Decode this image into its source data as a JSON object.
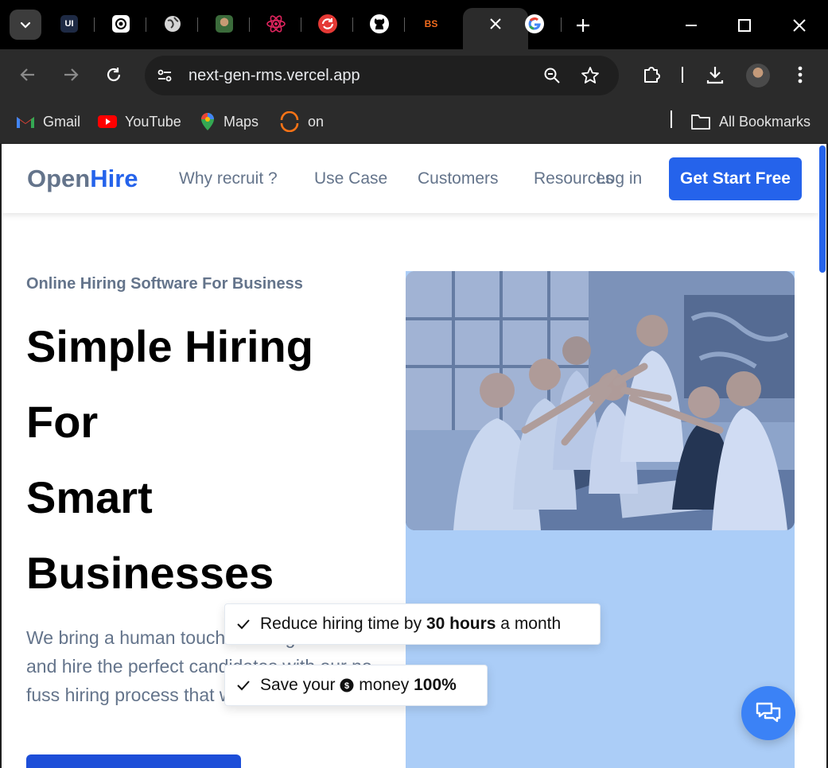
{
  "browser": {
    "tabs": [
      {
        "icon": "uiverse-icon",
        "label": "UI"
      },
      {
        "icon": "chatgpt-icon",
        "label": ""
      },
      {
        "icon": "globe-icon",
        "label": ""
      },
      {
        "icon": "profile-photo-icon",
        "label": ""
      },
      {
        "icon": "react-icon",
        "label": ""
      },
      {
        "icon": "sync-icon",
        "label": ""
      },
      {
        "icon": "github-icon",
        "label": ""
      },
      {
        "icon": "bs-icon",
        "label": "BS"
      },
      {
        "icon": "close-icon",
        "label": "",
        "active": true
      },
      {
        "icon": "google-icon",
        "label": ""
      }
    ],
    "url": "next-gen-rms.vercel.app",
    "bookmarks": [
      {
        "icon": "gmail-icon",
        "label": "Gmail"
      },
      {
        "icon": "youtube-icon",
        "label": "YouTube"
      },
      {
        "icon": "maps-icon",
        "label": "Maps"
      },
      {
        "icon": "loader-icon",
        "label": "on"
      }
    ],
    "all_bookmarks": "All Bookmarks"
  },
  "site": {
    "logo_part1": "Open",
    "logo_part2": "Hire",
    "nav": [
      "Why recruit ?",
      "Use Case",
      "Customers",
      "Resources"
    ],
    "login": "Log in",
    "cta": "Get Start Free",
    "eyebrow": "Online Hiring Software For Business",
    "headline": [
      "Simple Hiring",
      "For",
      "Smart",
      "Businesses"
    ],
    "body": "We bring a human touch to hiring. Discover and hire the perfect candidates with our no-fuss hiring process that works.",
    "chip1": {
      "pre": "Reduce hiring time by ",
      "bold": "30 hours",
      "post": " a month"
    },
    "chip2": {
      "pre": "Save your ",
      "mid": " money ",
      "bold": "100%"
    }
  },
  "colors": {
    "brand": "#2563eb",
    "muted_text": "#64748b",
    "image_panel": "#abcdf7"
  }
}
